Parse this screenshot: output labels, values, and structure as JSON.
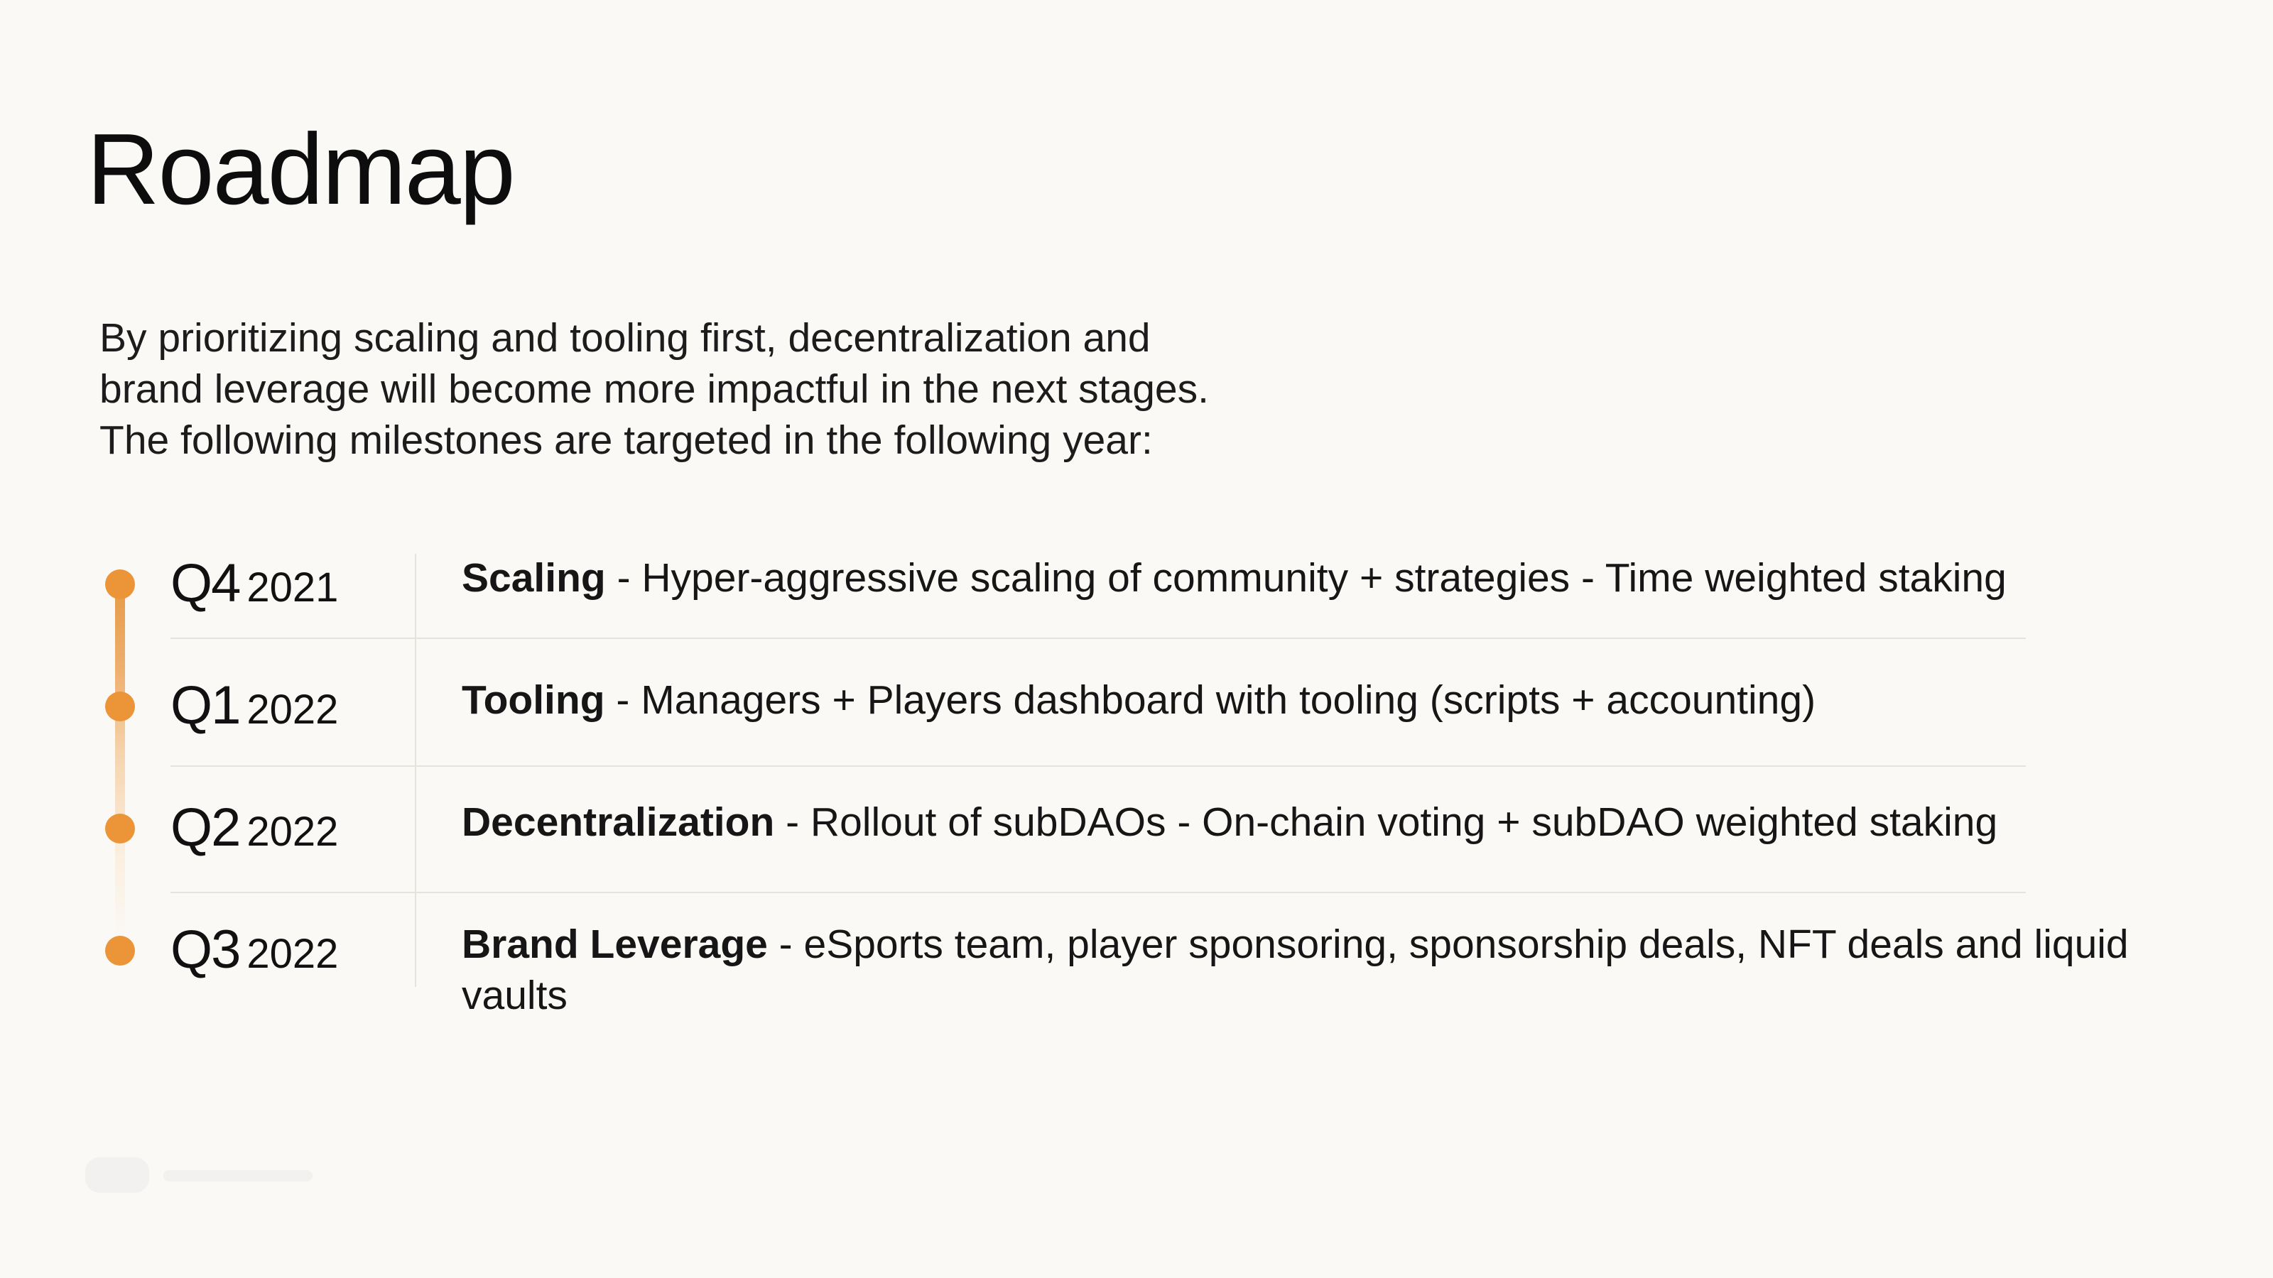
{
  "title": "Roadmap",
  "intro": [
    "By prioritizing scaling and tooling first, decentralization and",
    "brand leverage will become more impactful in the next stages.",
    "The following milestones are targeted in the following year:"
  ],
  "milestones": [
    {
      "quarter": "Q4",
      "year": "2021",
      "heading": "Scaling",
      "text": " - Hyper-aggressive scaling of community + strategies - Time weighted staking"
    },
    {
      "quarter": "Q1",
      "year": "2022",
      "heading": "Tooling",
      "text": " - Managers + Players dashboard with tooling (scripts + accounting)"
    },
    {
      "quarter": "Q2",
      "year": "2022",
      "heading": "Decentralization",
      "text": " - Rollout of subDAOs - On-chain voting + subDAO weighted staking"
    },
    {
      "quarter": "Q3",
      "year": "2022",
      "heading": "Brand Leverage",
      "text": " - eSports team, player sponsoring, sponsorship deals, NFT deals and liquid vaults"
    }
  ],
  "colors": {
    "background": "#faf9f6",
    "accent": "#eb9538",
    "text": "#141414",
    "divider": "#e6e3de"
  }
}
